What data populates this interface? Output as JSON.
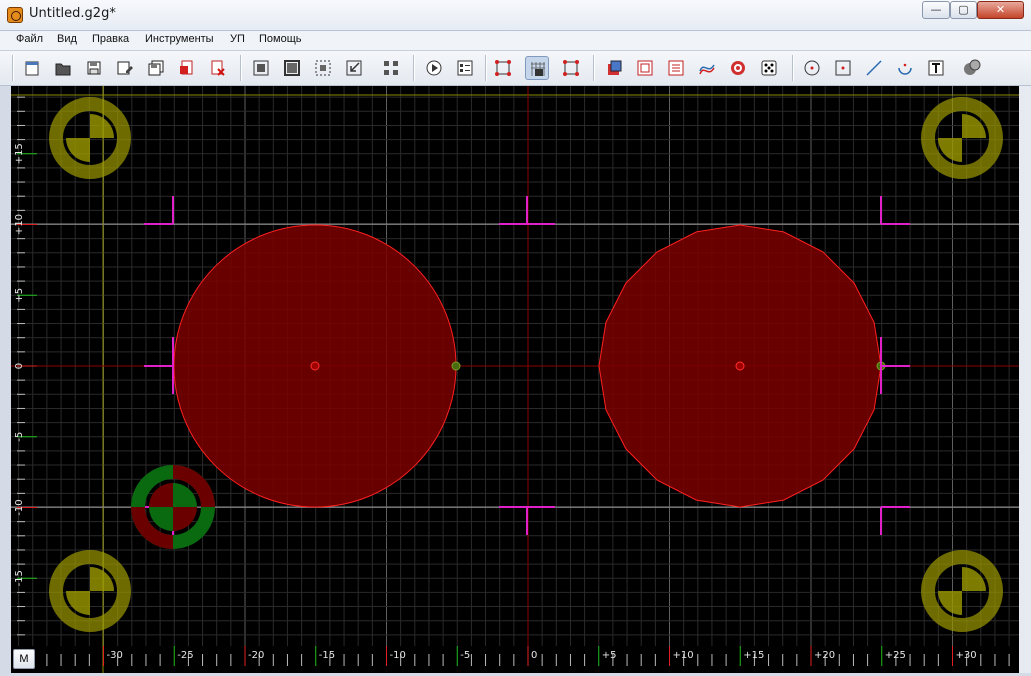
{
  "window": {
    "title": "Untitled.g2g*",
    "buttons": {
      "minimize": "—",
      "maximize": "▢",
      "close": "✕"
    }
  },
  "menu": {
    "items": [
      "Файл",
      "Вид",
      "Правка",
      "Инструменты",
      "УП",
      "Помощь"
    ]
  },
  "toolbar": {
    "icons": [
      "new-file-icon",
      "open-folder-icon",
      "save-icon",
      "save-as-icon",
      "save-all-icon",
      "import-icon",
      "delete-icon",
      "zoom-fit-icon",
      "zoom-extents-icon",
      "zoom-window-icon",
      "zoom-previous-icon",
      "select-all-icon",
      "run-icon",
      "properties-icon",
      "toolpath-icon",
      "snap-grid-icon",
      "bounds-icon",
      "layer-front-icon",
      "layer-back-icon",
      "layers-icon",
      "offset-icon",
      "target-icon",
      "dice-icon",
      "circle-tool-icon",
      "point-tool-icon",
      "line-tool-icon",
      "arc-tool-icon",
      "text-tool-icon",
      "help-icon"
    ],
    "active_icon": "snap-grid-icon"
  },
  "canvas": {
    "background": "#000000",
    "grid_color": "#2a2a2a",
    "major_grid_color": "#5e5e5e",
    "shape_fill": "#7a0000",
    "shape_stroke": "#ff2020",
    "mark_color": "#e020c8",
    "fiducial_color": "#9c9a00",
    "x_axis_labels": [
      "-30",
      "-25",
      "-20",
      "-15",
      "-10",
      "-5",
      "0",
      "+5",
      "+10",
      "+15",
      "+20",
      "+25",
      "+30"
    ],
    "y_axis_labels": [
      "+15",
      "+10",
      "+5",
      "0",
      "-5",
      "-10",
      "-15"
    ]
  },
  "bottom": {
    "mode_button": "M"
  }
}
